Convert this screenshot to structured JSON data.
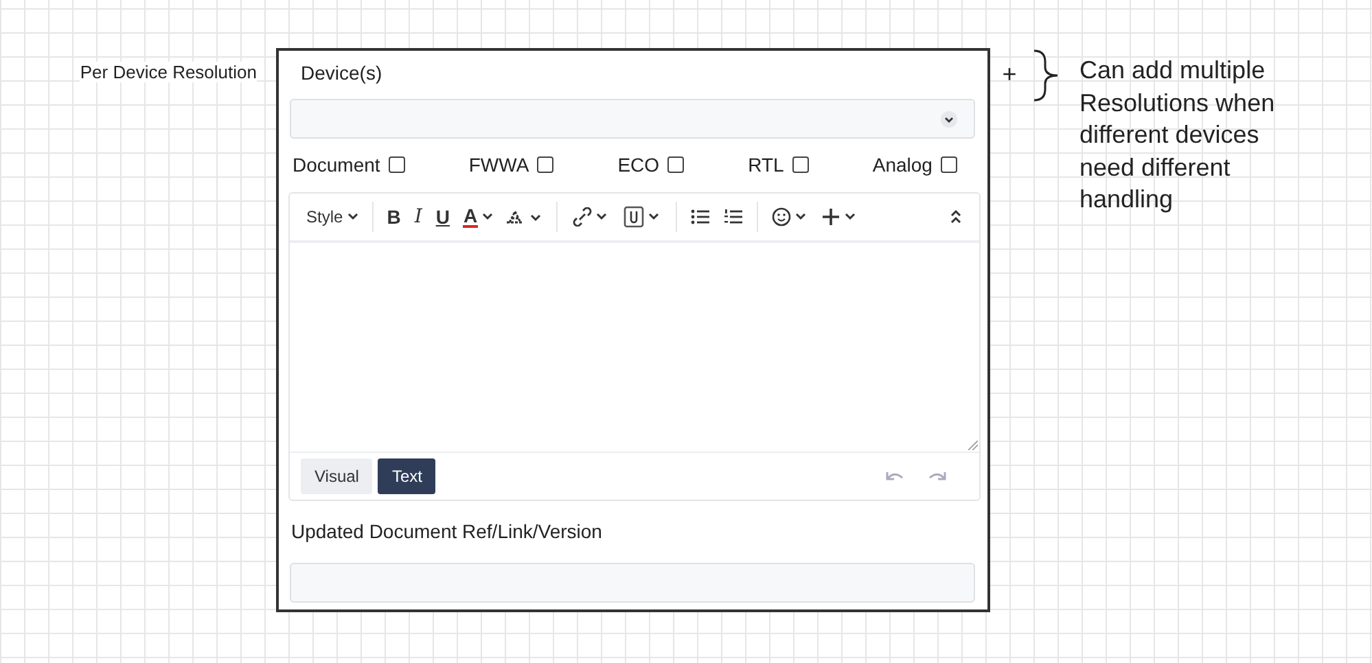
{
  "row_label": "Per Device Resolution",
  "form": {
    "devices_label": "Device(s)",
    "checkboxes": [
      {
        "label": "Document",
        "checked": false
      },
      {
        "label": "FWWA",
        "checked": false
      },
      {
        "label": "ECO",
        "checked": false
      },
      {
        "label": "RTL",
        "checked": false
      },
      {
        "label": "Analog",
        "checked": false
      }
    ],
    "editor": {
      "toolbar": {
        "style": "Style",
        "bold": "B",
        "italic": "I",
        "underline": "U",
        "text_color": "A"
      },
      "tabs": [
        {
          "label": "Visual",
          "selected": false
        },
        {
          "label": "Text",
          "selected": true
        }
      ]
    },
    "ref_label": "Updated Document Ref/Link/Version"
  },
  "add_button": "+",
  "note": "Can add multiple Resolutions when different devices need different handling"
}
